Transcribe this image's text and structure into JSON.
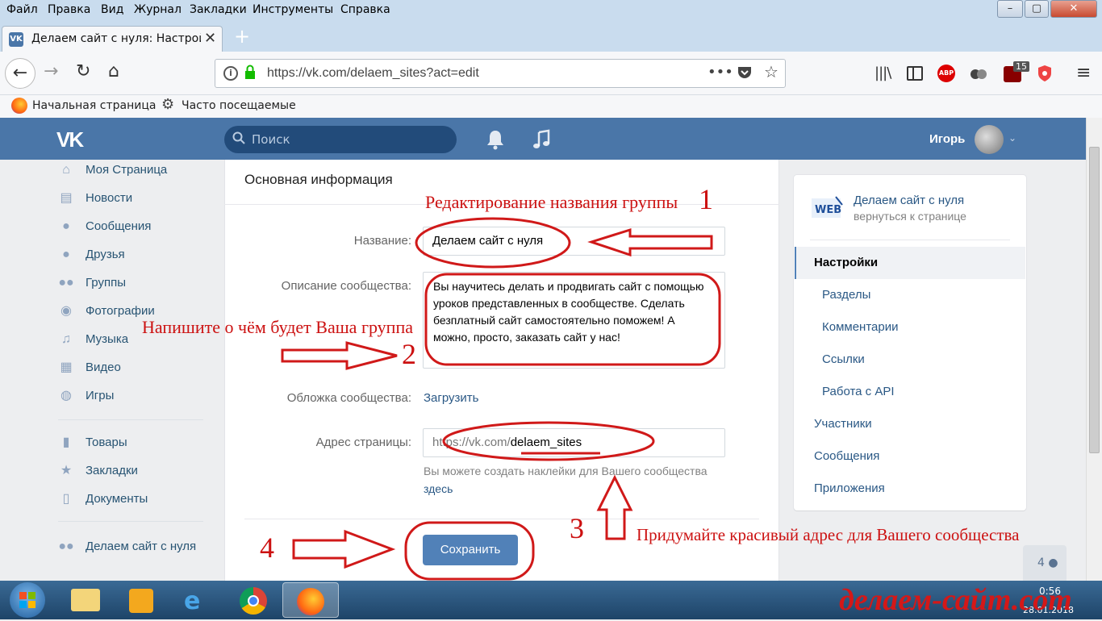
{
  "browser": {
    "menu": [
      "Файл",
      "Правка",
      "Вид",
      "Журнал",
      "Закладки",
      "Инструменты",
      "Справка"
    ],
    "tab_title": "Делаем сайт с нуля: Настройк",
    "url": "https://vk.com/delaem_sites?act=edit",
    "ublock_badge": "15",
    "abp_label": "ABP",
    "bookmarks": [
      "Начальная страница",
      "Часто посещаемые"
    ],
    "window_controls": [
      "–",
      "▢",
      "✕"
    ]
  },
  "vk": {
    "logo": "VK",
    "search_placeholder": "Поиск",
    "user_name": "Игорь",
    "left_menu": [
      "Моя Страница",
      "Новости",
      "Сообщения",
      "Друзья",
      "Группы",
      "Фотографии",
      "Музыка",
      "Видео",
      "Игры",
      "Товары",
      "Закладки",
      "Документы",
      "Делаем сайт с нуля"
    ],
    "section_title": "Основная информация",
    "form": {
      "name_label": "Название:",
      "name_value": "Делаем сайт с нуля",
      "desc_label": "Описание сообщества:",
      "desc_value": "Вы научитесь делать и продвигать сайт с помощью уроков представленных в сообществе. Сделать безплатный сайт самостоятельно поможем! А можно, просто, заказать сайт у нас!",
      "cover_label": "Обложка сообщества:",
      "cover_action": "Загрузить",
      "address_label": "Адрес страницы:",
      "address_prefix": "https://vk.com/",
      "address_value": "delaem_sites",
      "hint_text": "Вы можете создать наклейки для Вашего сообщества",
      "hint_link": "здесь",
      "save_button": "Сохранить"
    },
    "right_menu": {
      "group_name": "Делаем сайт с нуля",
      "back_link": "вернуться к странице",
      "items": [
        "Настройки",
        "Разделы",
        "Комментарии",
        "Ссылки",
        "Работа с API",
        "Участники",
        "Сообщения",
        "Приложения"
      ]
    },
    "online_count": "4"
  },
  "annotations": {
    "a1_text": "Редактирование названия группы",
    "a1_num": "1",
    "a2_text": "Напишите о чём будет Ваша группа",
    "a2_num": "2",
    "a3_text": "Придумайте красивый адрес для Вашего сообщества",
    "a3_num": "3",
    "a4_num": "4",
    "watermark": "делаем-сайт.com"
  },
  "taskbar": {
    "time": "0:56",
    "date": "28.01.2018"
  },
  "colors": {
    "vk_blue": "#4a76a8",
    "link": "#2a5885",
    "annotation_red": "#cc1111",
    "save_button": "#5181b8"
  }
}
